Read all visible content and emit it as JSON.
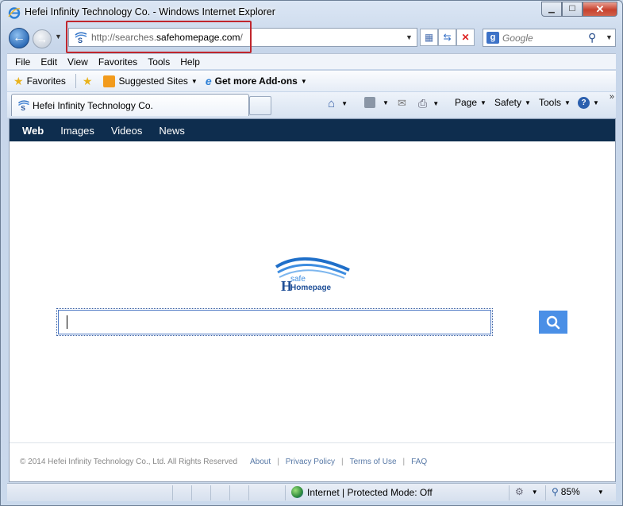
{
  "window": {
    "title": "Hefei Infinity Technology Co. - Windows Internet Explorer"
  },
  "address": {
    "url_prefix": "http://searches.",
    "url_domain": "safehomepage.com",
    "url_suffix": "/"
  },
  "search": {
    "placeholder": "Google"
  },
  "menu": {
    "items": [
      "File",
      "Edit",
      "View",
      "Favorites",
      "Tools",
      "Help"
    ]
  },
  "favorites_bar": {
    "favorites": "Favorites",
    "suggested": "Suggested Sites",
    "addons": "Get more Add-ons"
  },
  "tab": {
    "title": "Hefei Infinity Technology Co."
  },
  "commands": {
    "page": "Page",
    "safety": "Safety",
    "tools": "Tools"
  },
  "site_nav": {
    "items": [
      "Web",
      "Images",
      "Videos",
      "News"
    ]
  },
  "logo": {
    "text_top": "safe",
    "text_bottom": "Homepage"
  },
  "footer": {
    "copyright": "© 2014 Hefei Infinity Technology Co., Ltd. All Rights Reserved",
    "links": [
      "About",
      "Privacy Policy",
      "Terms of Use",
      "FAQ"
    ]
  },
  "status": {
    "zone": "Internet | Protected Mode: Off",
    "zoom": "85%"
  },
  "colors": {
    "site_nav_bg": "#0e2d4e",
    "search_button": "#4a8fe6",
    "highlight_box": "#c0262d"
  }
}
